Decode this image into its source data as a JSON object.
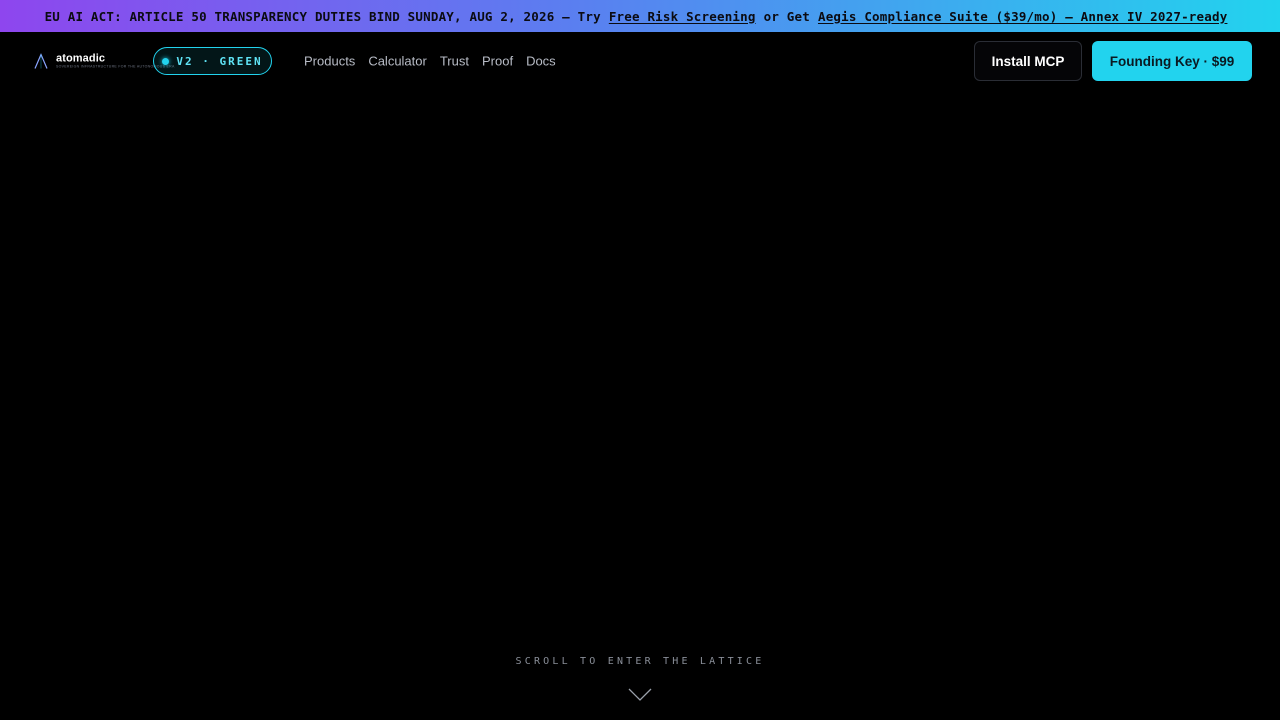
{
  "banner": {
    "lead": "EU AI ACT: ARTICLE 50 TRANSPARENCY DUTIES BIND SUNDAY, AUG 2, 2026 — Try",
    "link_1": "Free Risk Screening",
    "middle": "or Get",
    "link_2": "Aegis Compliance Suite ($39/mo) — Annex IV 2027-ready"
  },
  "brand": {
    "name": "atomadic",
    "tagline": "sovereign infrastructure for the autonomous era",
    "icon": "lambda-logo-icon",
    "accent_color": "#22d3ee"
  },
  "version_badge": {
    "label": "V2 · GREEN",
    "icon": "status-dot-icon"
  },
  "nav": {
    "links": [
      "Products",
      "Calculator",
      "Trust",
      "Proof",
      "Docs"
    ]
  },
  "actions": {
    "install_label": "Install MCP",
    "founding_label": "Founding Key · $99"
  },
  "hero": {
    "scroll_hint": "SCROLL TO ENTER THE LATTICE",
    "scroll_icon": "chevron-down-icon"
  }
}
